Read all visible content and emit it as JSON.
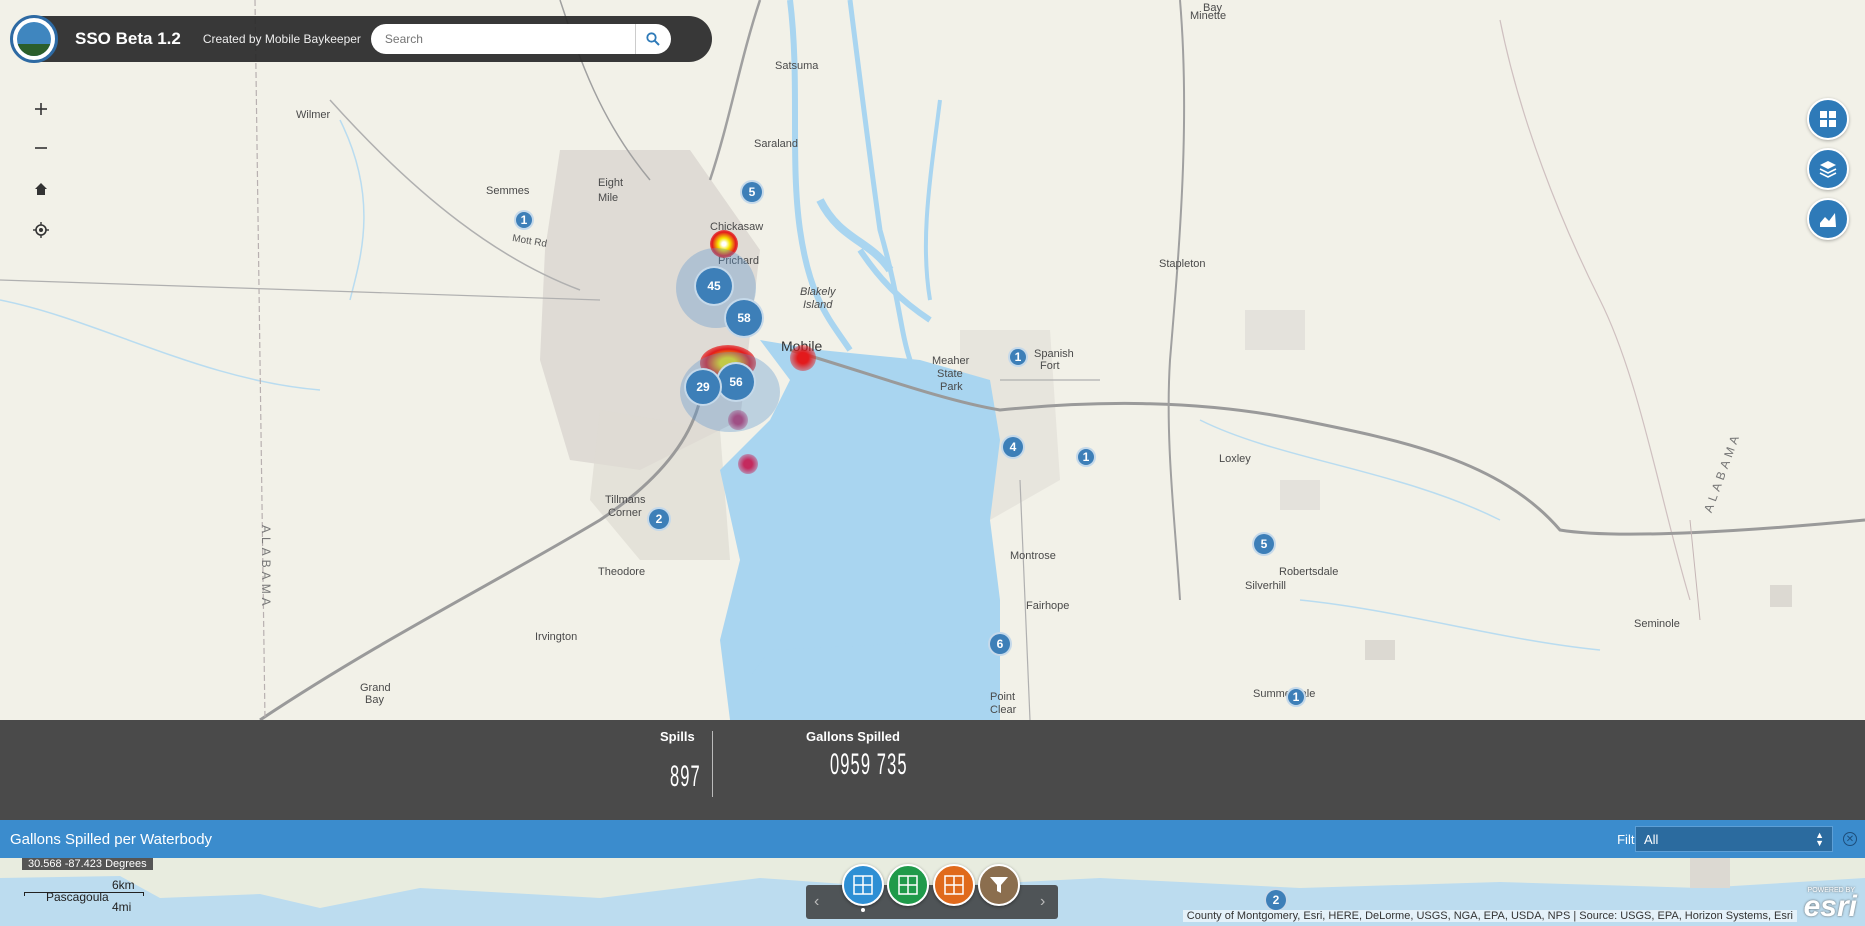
{
  "header": {
    "title": "SSO Beta 1.2",
    "subtitle": "Created by Mobile Baykeeper",
    "search_placeholder": "Search"
  },
  "map": {
    "places": [
      {
        "text": "Wilmer"
      },
      {
        "text": "Semmes"
      },
      {
        "text": "Eight"
      },
      {
        "text": "Mile"
      },
      {
        "text": "Satsuma"
      },
      {
        "text": "Saraland"
      },
      {
        "text": "Chickasaw"
      },
      {
        "text": "Prichard"
      },
      {
        "text": "Mobile"
      },
      {
        "text": "Blakely"
      },
      {
        "text": "Island"
      },
      {
        "text": "Spanish"
      },
      {
        "text": "Fort"
      },
      {
        "text": "Meaher"
      },
      {
        "text": "State"
      },
      {
        "text": "Park"
      },
      {
        "text": "Stapleton"
      },
      {
        "text": "Loxley"
      },
      {
        "text": "Tillmans"
      },
      {
        "text": "Corner"
      },
      {
        "text": "Theodore"
      },
      {
        "text": "Montrose"
      },
      {
        "text": "Robertsdale"
      },
      {
        "text": "Silverhill"
      },
      {
        "text": "Fairhope"
      },
      {
        "text": "Irvington"
      },
      {
        "text": "Grand"
      },
      {
        "text": "Bay"
      },
      {
        "text": "Seminole"
      },
      {
        "text": "Summerdale"
      },
      {
        "text": "Point"
      },
      {
        "text": "Clear"
      },
      {
        "text": "Bay"
      },
      {
        "text": "Minette"
      },
      {
        "text": "Mott Rd"
      },
      {
        "text": "ALABAMA"
      },
      {
        "text": "ALABAMA"
      },
      {
        "text": "Grand"
      },
      {
        "text": "Bay"
      }
    ],
    "clusters": [
      {
        "count": "45"
      },
      {
        "count": "58"
      },
      {
        "count": "56"
      },
      {
        "count": "29"
      },
      {
        "count": "5"
      },
      {
        "count": "1"
      },
      {
        "count": "1"
      },
      {
        "count": "4"
      },
      {
        "count": "1"
      },
      {
        "count": "2"
      },
      {
        "count": "5"
      },
      {
        "count": "6"
      },
      {
        "count": "1"
      },
      {
        "count": "2"
      }
    ]
  },
  "stats": {
    "spills_label": "Spills",
    "spills_value": "897",
    "gallons_label": "Gallons Spilled",
    "gallons_value": "0959 735"
  },
  "waterbody": {
    "title": "Gallons Spilled per Waterbody",
    "filter_label": "Filter",
    "filter_value": "All"
  },
  "footer": {
    "coords": "30.568 -87.423 Degrees",
    "scale_km": "6km",
    "scale_mi": "4mi",
    "scale_place": "Pascagoula",
    "attribution": "County of Montgomery, Esri, HERE, DeLorme, USGS, NGA, EPA, USDA, NPS | Source: USGS, EPA, Horizon Systems, Esri",
    "esri": "esri",
    "esri_powered": "POWERED BY"
  },
  "icons": {
    "zoom_in": "plus-icon",
    "zoom_out": "minus-icon",
    "home": "home-icon",
    "locate": "locate-icon",
    "grid": "grid-icon",
    "layers": "layers-icon",
    "chart": "chart-icon",
    "filter": "filter-icon"
  },
  "colors": {
    "header_bg": "#282828",
    "accent_blue": "#2e7ab8",
    "waterbody_bar": "#3b8ccd",
    "stats_bg": "#4a4a4a",
    "widget_green": "#1f9a4a",
    "widget_orange": "#e06a1c",
    "widget_brown": "#8b6e4e"
  }
}
